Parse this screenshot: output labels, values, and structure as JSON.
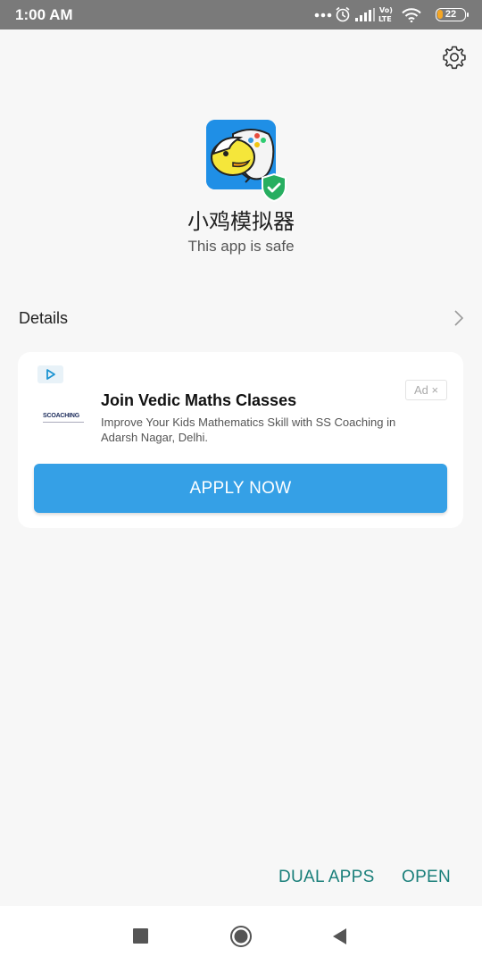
{
  "status_bar": {
    "time": "1:00 AM",
    "battery": "22",
    "icons": [
      "more-dots-icon",
      "alarm-icon",
      "signal-icon",
      "volte-icon",
      "wifi-icon",
      "battery-icon"
    ]
  },
  "app": {
    "name": "小鸡模拟器",
    "status": "This app is safe",
    "icon": "happy-chick-app-icon"
  },
  "details": {
    "label": "Details"
  },
  "ad": {
    "logo_text": "SCOACHING",
    "badge": "Ad ×",
    "title": "Join Vedic Maths Classes",
    "description": "Improve Your Kids Mathematics Skill with SS Coaching in Adarsh Nagar, Delhi.",
    "cta": "APPLY NOW"
  },
  "actions": {
    "dual_apps": "DUAL APPS",
    "open": "OPEN"
  },
  "colors": {
    "status_bar": "#7a7a7a",
    "background": "#f7f7f7",
    "cta_button": "#35a0e6",
    "action_text": "#1a7f7a",
    "safe_green": "#27ae60"
  }
}
